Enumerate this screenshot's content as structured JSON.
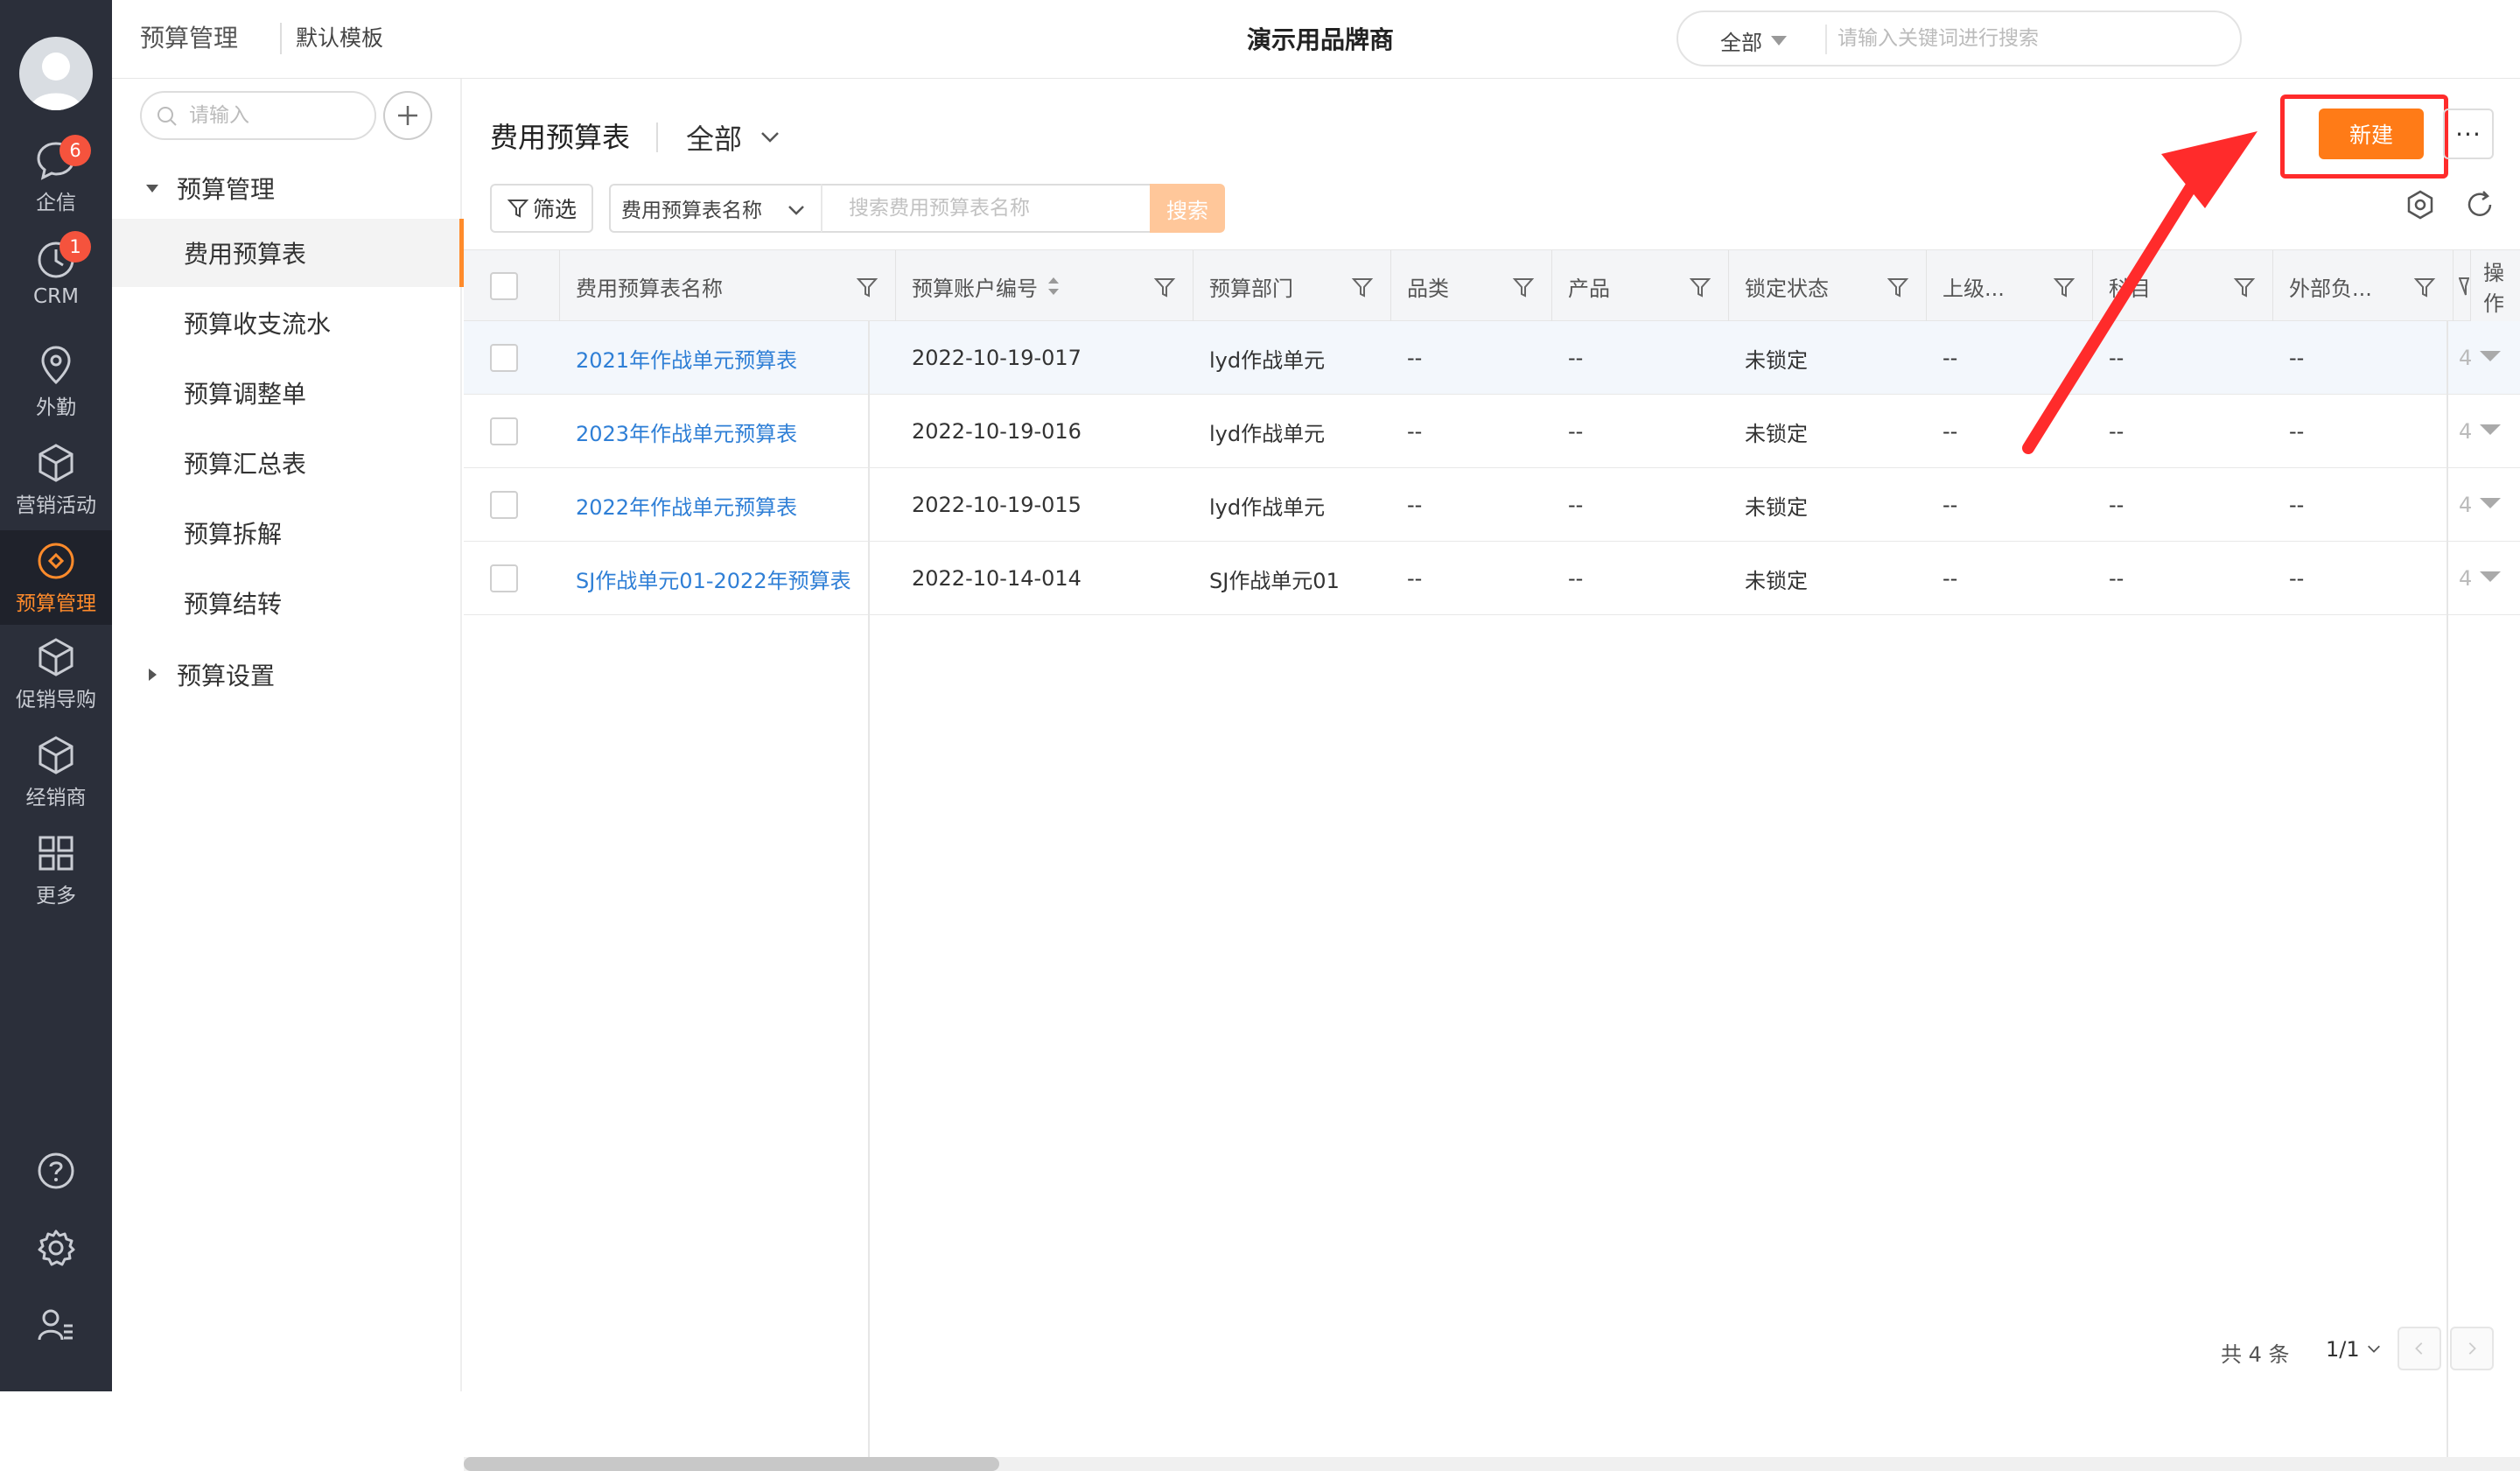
{
  "nav": {
    "items": [
      {
        "label": "企信",
        "icon": "chat-bubble-icon",
        "badge": "6"
      },
      {
        "label": "CRM",
        "icon": "clock-icon",
        "badge": "1"
      },
      {
        "label": "外勤",
        "icon": "location-pin-icon"
      },
      {
        "label": "营销活动",
        "icon": "cube-icon"
      },
      {
        "label": "预算管理",
        "icon": "budget-diamond-icon",
        "active": true
      },
      {
        "label": "促销导购",
        "icon": "cube-icon"
      },
      {
        "label": "经销商",
        "icon": "cube-icon"
      },
      {
        "label": "更多",
        "icon": "grid-icon"
      }
    ],
    "bottom_icons": [
      "help-icon",
      "settings-gear-icon",
      "user-list-icon"
    ]
  },
  "topbar": {
    "breadcrumb": "预算管理",
    "template": "默认模板",
    "brand": "演示用品牌商",
    "search_scope": "全部",
    "search_placeholder": "请输入关键词进行搜索"
  },
  "sidebar": {
    "search_placeholder": "请输入",
    "group_label": "预算管理",
    "items": [
      {
        "label": "费用预算表",
        "active": true
      },
      {
        "label": "预算收支流水"
      },
      {
        "label": "预算调整单"
      },
      {
        "label": "预算汇总表"
      },
      {
        "label": "预算拆解"
      },
      {
        "label": "预算结转"
      }
    ],
    "settings_label": "预算设置"
  },
  "main": {
    "title": "费用预算表",
    "scope": "全部",
    "new_button": "新建",
    "more_button": "···",
    "filter_button": "筛选",
    "field_select": "费用预算表名称",
    "search_placeholder": "搜索费用预算表名称",
    "search_button": "搜索"
  },
  "table": {
    "columns": [
      "费用预算表名称",
      "预算账户编号",
      "预算部门",
      "品类",
      "产品",
      "锁定状态",
      "上级...",
      "科目",
      "外部负...",
      "操作"
    ],
    "rows": [
      {
        "name": "2021年作战单元预算表",
        "code": "2022-10-19-017",
        "dept": "lyd作战单元",
        "category": "--",
        "product": "--",
        "lock": "未锁定",
        "parent": "--",
        "subject": "--",
        "external": "--",
        "extra": "4"
      },
      {
        "name": "2023年作战单元预算表",
        "code": "2022-10-19-016",
        "dept": "lyd作战单元",
        "category": "--",
        "product": "--",
        "lock": "未锁定",
        "parent": "--",
        "subject": "--",
        "external": "--",
        "extra": "4"
      },
      {
        "name": "2022年作战单元预算表",
        "code": "2022-10-19-015",
        "dept": "lyd作战单元",
        "category": "--",
        "product": "--",
        "lock": "未锁定",
        "parent": "--",
        "subject": "--",
        "external": "--",
        "extra": "4"
      },
      {
        "name": "SJ作战单元01-2022年预算表",
        "code": "2022-10-14-014",
        "dept": "SJ作战单元01",
        "category": "--",
        "product": "--",
        "lock": "未锁定",
        "parent": "--",
        "subject": "--",
        "external": "--",
        "extra": "4"
      }
    ]
  },
  "pager": {
    "total": "共 4 条",
    "page": "1/1"
  },
  "colors": {
    "accent": "#ff7b17",
    "nav_bg": "#2b2f3a",
    "link": "#2f7fd6",
    "annotation_red": "#ff2b2b"
  }
}
